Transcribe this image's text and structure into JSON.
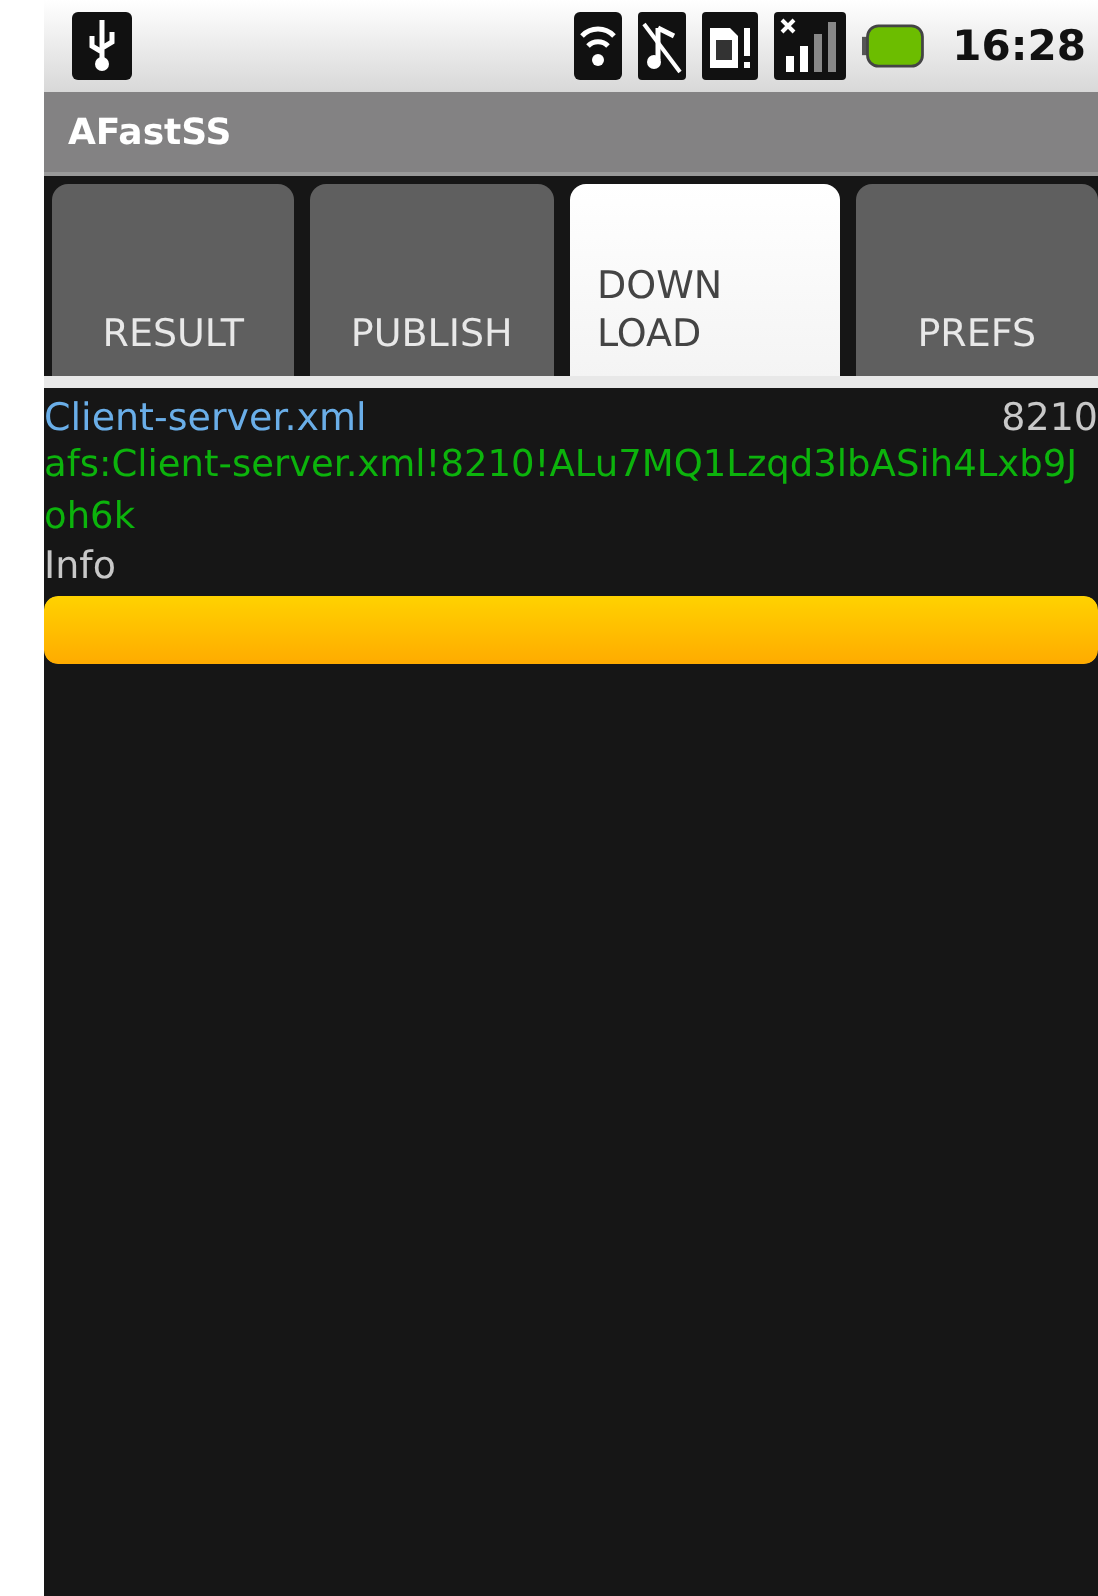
{
  "status_bar": {
    "time": "16:28"
  },
  "title_bar": {
    "title": "AFastSS"
  },
  "tabs": [
    {
      "label": "RESULT",
      "selected": false
    },
    {
      "label": "PUBLISH",
      "selected": false
    },
    {
      "label": "DOWN\nLOAD",
      "selected": true
    },
    {
      "label": "PREFS",
      "selected": false
    }
  ],
  "download": {
    "file_name": "Client-server.xml",
    "size": "8210",
    "link": "afs:Client-server.xml!8210!ALu7MQ1Lzqd3lbASih4Lxb9Joh6k",
    "info_label": "Info",
    "progress": {
      "level": 1
    }
  }
}
